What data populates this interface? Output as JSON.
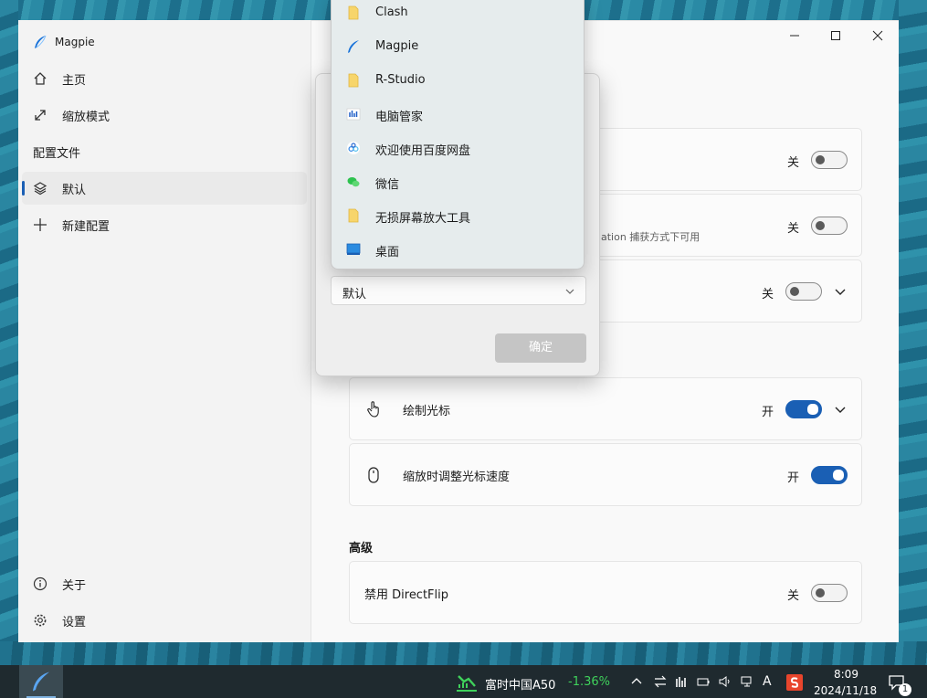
{
  "window": {
    "app_name": "Magpie"
  },
  "sidebar": {
    "home": "主页",
    "scaling_modes": "缩放模式",
    "profiles_header": "配置文件",
    "default_profile": "默认",
    "new_profile": "新建配置",
    "about": "关于",
    "settings": "设置"
  },
  "settings_cards": {
    "card1": {
      "state": "关"
    },
    "card2": {
      "desc": "ation 捕获方式下可用",
      "state": "关"
    },
    "card3": {
      "state": "关"
    },
    "draw_cursor": {
      "title": "绘制光标",
      "state": "开"
    },
    "cursor_speed": {
      "title": "缩放时调整光标速度",
      "state": "开"
    },
    "advanced_header": "高级",
    "directflip": {
      "title": "禁用 DirectFlip",
      "state": "关"
    }
  },
  "dialog": {
    "combo_value": "默认",
    "ok_button": "确定"
  },
  "dropdown": {
    "items": [
      {
        "label": "Clash",
        "icon": "folder-icon"
      },
      {
        "label": "Magpie",
        "icon": "magpie-feather-icon"
      },
      {
        "label": "R-Studio",
        "icon": "folder-icon"
      },
      {
        "label": "电脑管家",
        "icon": "pc-manager-icon"
      },
      {
        "label": "欢迎使用百度网盘",
        "icon": "baidu-netdisk-icon"
      },
      {
        "label": "微信",
        "icon": "wechat-icon"
      },
      {
        "label": "无损屏幕放大工具",
        "icon": "folder-icon"
      },
      {
        "label": "桌面",
        "icon": "desktop-icon"
      }
    ]
  },
  "taskbar": {
    "stock_name": "富时中国A50",
    "stock_change": "-1.36%",
    "ime": "A",
    "time": "8:09",
    "date": "2024/11/18",
    "notification_count": "1"
  },
  "colors": {
    "accent": "#1a5fb4",
    "stock_change": "#3fd15b"
  }
}
